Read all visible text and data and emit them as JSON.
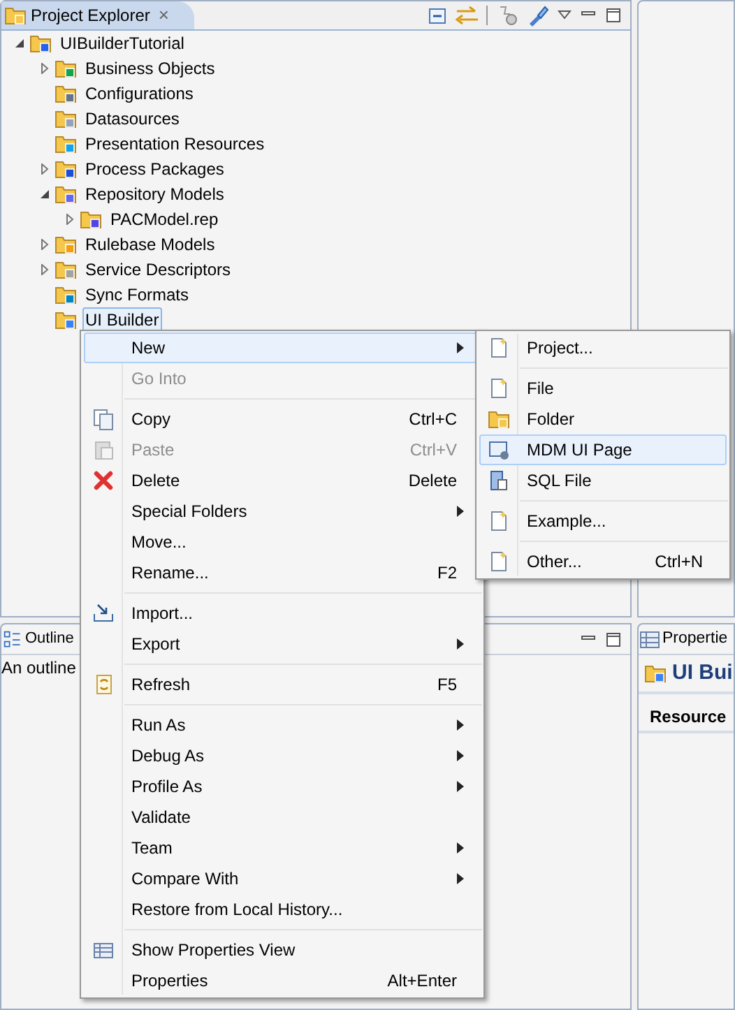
{
  "explorer": {
    "title": "Project Explorer",
    "close": "×",
    "tree": [
      {
        "label": "UIBuilderTutorial",
        "expanded": true,
        "selected": false,
        "children": [
          {
            "label": "Business Objects",
            "expanded": false,
            "selected": false
          },
          {
            "label": "Configurations",
            "selected": false
          },
          {
            "label": "Datasources",
            "selected": false
          },
          {
            "label": "Presentation Resources",
            "selected": false
          },
          {
            "label": "Process Packages",
            "expanded": false,
            "selected": false
          },
          {
            "label": "Repository Models",
            "expanded": true,
            "selected": false,
            "children": [
              {
                "label": "PACModel.rep",
                "expanded": false,
                "selected": false
              }
            ]
          },
          {
            "label": "Rulebase Models",
            "expanded": false,
            "selected": false
          },
          {
            "label": "Service Descriptors",
            "expanded": false,
            "selected": false
          },
          {
            "label": "Sync Formats",
            "selected": false
          },
          {
            "label": "UI Builder",
            "selected": true
          }
        ]
      }
    ]
  },
  "outline": {
    "title": "Outline",
    "message": "An outline"
  },
  "properties": {
    "title": "Propertie",
    "heading": "UI Bui",
    "tab": "Resource"
  },
  "context_menu": [
    {
      "kind": "item",
      "label": "New",
      "submenu": true,
      "selected": true,
      "disabled": false
    },
    {
      "kind": "item",
      "label": "Go Into",
      "disabled": true,
      "selected": false
    },
    {
      "kind": "separator"
    },
    {
      "kind": "item",
      "label": "Copy",
      "shortcut": "Ctrl+C",
      "disabled": false,
      "selected": false
    },
    {
      "kind": "item",
      "label": "Paste",
      "shortcut": "Ctrl+V",
      "disabled": true,
      "selected": false
    },
    {
      "kind": "item",
      "label": "Delete",
      "shortcut": "Delete",
      "disabled": false,
      "selected": false
    },
    {
      "kind": "item",
      "label": "Special Folders",
      "submenu": true,
      "disabled": false,
      "selected": false
    },
    {
      "kind": "item",
      "label": "Move...",
      "disabled": false,
      "selected": false
    },
    {
      "kind": "item",
      "label": "Rename...",
      "shortcut": "F2",
      "disabled": false,
      "selected": false
    },
    {
      "kind": "separator"
    },
    {
      "kind": "item",
      "label": "Import...",
      "disabled": false,
      "selected": false
    },
    {
      "kind": "item",
      "label": "Export",
      "submenu": true,
      "disabled": false,
      "selected": false
    },
    {
      "kind": "separator"
    },
    {
      "kind": "item",
      "label": "Refresh",
      "shortcut": "F5",
      "disabled": false,
      "selected": false
    },
    {
      "kind": "separator"
    },
    {
      "kind": "item",
      "label": "Run As",
      "submenu": true,
      "disabled": false,
      "selected": false
    },
    {
      "kind": "item",
      "label": "Debug As",
      "submenu": true,
      "disabled": false,
      "selected": false
    },
    {
      "kind": "item",
      "label": "Profile As",
      "submenu": true,
      "disabled": false,
      "selected": false
    },
    {
      "kind": "item",
      "label": "Validate",
      "disabled": false,
      "selected": false
    },
    {
      "kind": "item",
      "label": "Team",
      "submenu": true,
      "disabled": false,
      "selected": false
    },
    {
      "kind": "item",
      "label": "Compare With",
      "submenu": true,
      "disabled": false,
      "selected": false
    },
    {
      "kind": "item",
      "label": "Restore from Local History...",
      "disabled": false,
      "selected": false
    },
    {
      "kind": "separator"
    },
    {
      "kind": "item",
      "label": "Show Properties View",
      "disabled": false,
      "selected": false
    },
    {
      "kind": "item",
      "label": "Properties",
      "shortcut": "Alt+Enter",
      "disabled": false,
      "selected": false
    }
  ],
  "new_submenu": [
    {
      "kind": "item",
      "label": "Project...",
      "selected": false
    },
    {
      "kind": "separator"
    },
    {
      "kind": "item",
      "label": "File",
      "selected": false
    },
    {
      "kind": "item",
      "label": "Folder",
      "selected": false
    },
    {
      "kind": "item",
      "label": "MDM UI Page",
      "selected": true
    },
    {
      "kind": "item",
      "label": "SQL File",
      "selected": false
    },
    {
      "kind": "separator"
    },
    {
      "kind": "item",
      "label": "Example...",
      "selected": false
    },
    {
      "kind": "separator"
    },
    {
      "kind": "item",
      "label": "Other...",
      "shortcut": "Ctrl+N",
      "selected": false
    }
  ]
}
